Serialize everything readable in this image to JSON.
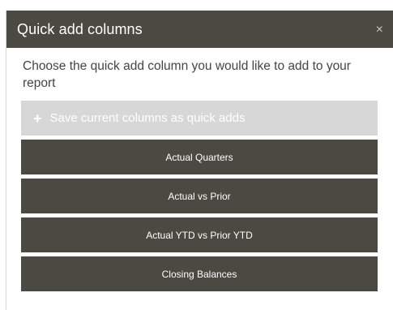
{
  "dialog": {
    "title": "Quick add columns",
    "close_glyph": "×",
    "prompt": "Choose the quick add column you would like to add to your report",
    "save_label": "Save current columns as quick adds",
    "save_icon": "plus-icon",
    "options": [
      {
        "label": "Actual Quarters"
      },
      {
        "label": "Actual vs Prior"
      },
      {
        "label": "Actual YTD vs Prior YTD"
      },
      {
        "label": "Closing Balances"
      }
    ]
  },
  "colors": {
    "header_bg": "#4a4942",
    "button_bg": "#4a4942",
    "save_row_bg": "#d7d7d7",
    "text": "#444444"
  }
}
